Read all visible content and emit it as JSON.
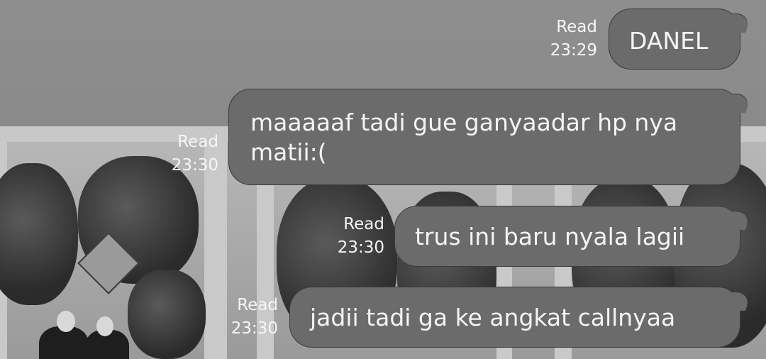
{
  "messages": [
    {
      "text": "DANEL",
      "status": "Read",
      "time": "23:29"
    },
    {
      "text": "maaaaaf tadi gue ganyaadar hp nya matii:(",
      "status": "Read",
      "time": "23:30"
    },
    {
      "text": "trus ini baru nyala lagii",
      "status": "Read",
      "time": "23:30"
    },
    {
      "text": "jadii tadi ga ke angkat callnyaa",
      "status": "Read",
      "time": "23:30"
    }
  ],
  "colors": {
    "bubble": "#6b6b6b",
    "bubble_border": "#3a3a3a",
    "text": "#f4f4f4"
  }
}
